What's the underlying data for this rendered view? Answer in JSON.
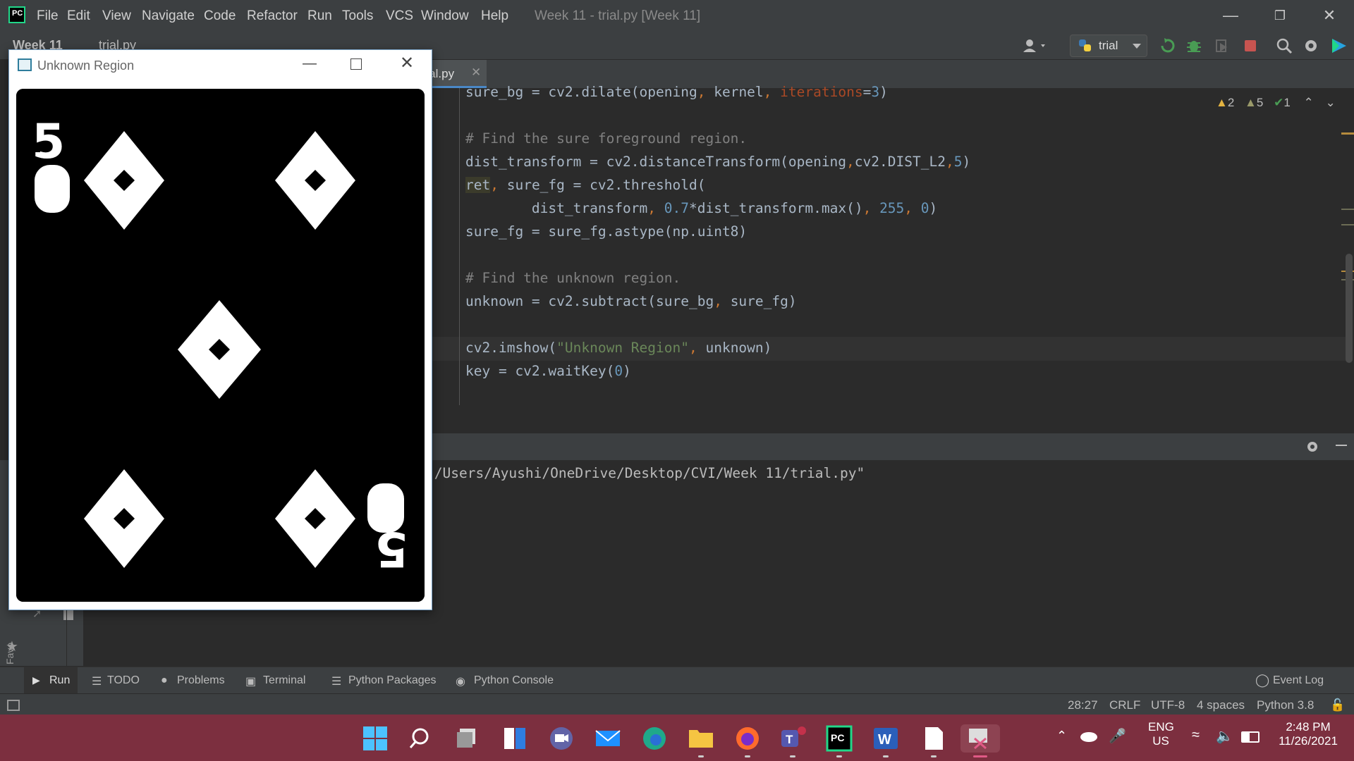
{
  "ide": {
    "menu": [
      "File",
      "Edit",
      "View",
      "Navigate",
      "Code",
      "Refactor",
      "Run",
      "Tools",
      "VCS",
      "Window",
      "Help"
    ],
    "window_title": "Week 11 - trial.py [Week 11]",
    "breadcrumb": [
      "Week 11",
      "trial.py"
    ],
    "run_config": "trial",
    "editor_tab": "trial.py",
    "inspections": {
      "warnings": "2",
      "weak_warnings": "5",
      "typos": "1"
    },
    "code_lines": [
      {
        "text": "sure_bg = cv2.dilate(opening, kernel, iterations=3)"
      },
      {
        "text": ""
      },
      {
        "text": "# Find the sure foreground region."
      },
      {
        "text": "dist_transform = cv2.distanceTransform(opening,cv2.DIST_L2,5)"
      },
      {
        "text": "ret, sure_fg = cv2.threshold("
      },
      {
        "text": "        dist_transform, 0.7*dist_transform.max(), 255, 0)"
      },
      {
        "text": "sure_fg = sure_fg.astype(np.uint8)"
      },
      {
        "text": ""
      },
      {
        "text": "# Find the unknown region."
      },
      {
        "text": "unknown = cv2.subtract(sure_bg, sure_fg)"
      },
      {
        "text": ""
      },
      {
        "text": "cv2.imshow(\"Unknown Region\", unknown)"
      },
      {
        "text": "key = cv2.waitKey(0)"
      }
    ],
    "run_output": ":/Users/Ayushi/OneDrive/Desktop/CVI/Week 11/trial.py\"",
    "favorites_label": "Favo",
    "tool_tabs": [
      "Run",
      "TODO",
      "Problems",
      "Terminal",
      "Python Packages",
      "Python Console"
    ],
    "event_log": "Event Log",
    "status": {
      "position": "28:27",
      "line_sep": "CRLF",
      "encoding": "UTF-8",
      "indent": "4 spaces",
      "interpreter": "Python 3.8"
    }
  },
  "cv_window": {
    "title": "Unknown Region",
    "card_rank_top": "5",
    "card_rank_bottom": "5"
  },
  "taskbar": {
    "lang_primary": "ENG",
    "lang_secondary": "US",
    "time": "2:48 PM",
    "date": "11/26/2021"
  },
  "colors": {
    "titlebar": "#3c3f41",
    "editor_bg": "#2b2b2b",
    "taskbar": "#7c2f3f",
    "run_green": "#499c54",
    "stop_red": "#c75450"
  }
}
